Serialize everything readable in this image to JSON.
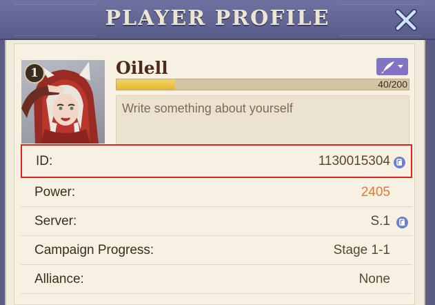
{
  "header": {
    "title": "PLAYER PROFILE",
    "close_icon": "close-x-icon"
  },
  "profile": {
    "level": "1",
    "name": "Oilell",
    "edit_icon": "quill-edit-icon",
    "xp_text": "40/200",
    "xp_fraction": 0.2,
    "bio_placeholder": "Write something about yourself"
  },
  "rows": [
    {
      "label": "ID:",
      "value": "1130015304",
      "copy": true,
      "highlighted": true
    },
    {
      "label": "Power:",
      "value": "2405",
      "accent": "#e8762a"
    },
    {
      "label": "Server:",
      "value": "S.1",
      "copy": true
    },
    {
      "label": "Campaign Progress:",
      "value": "Stage 1-1"
    },
    {
      "label": "Alliance:",
      "value": "None"
    }
  ],
  "colors": {
    "header_bg": "#5f6291",
    "panel_bg": "#f1ebdc",
    "power_value": "#e8762a",
    "copy_icon": "#6f7fd0",
    "edit_button": "#8174c4",
    "highlight_border": "#e0221e"
  }
}
